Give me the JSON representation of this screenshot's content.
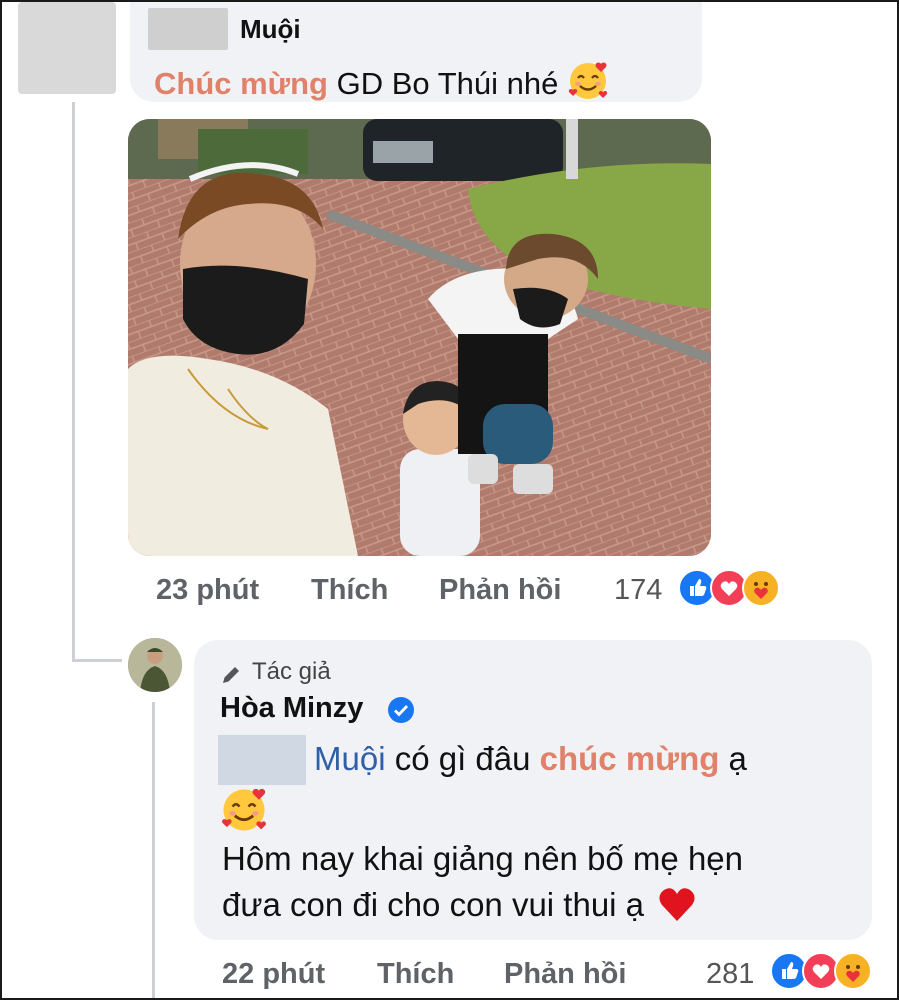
{
  "comment1": {
    "author": "Muội",
    "text_highlight": "Chúc mừng",
    "text_rest": " GD Bo Thúi nhé",
    "emoji": "smiling-face-with-hearts",
    "time": "23 phút",
    "like_label": "Thích",
    "reply_label": "Phản hồi",
    "reaction_count": "174",
    "reactions": [
      "like",
      "love",
      "care"
    ]
  },
  "reply": {
    "badge": "Tác giả",
    "author": "Hòa Minzy",
    "verified": true,
    "mention": "Muội",
    "text_mid": " có gì đâu ",
    "text_highlight": "chúc mừng",
    "text_end": " ạ",
    "line2": "Hôm nay khai giảng nên bố mẹ hẹn",
    "line3": "đưa con đi cho con vui thui ạ",
    "end_emoji": "red-heart",
    "time": "22 phút",
    "like_label": "Thích",
    "reply_label": "Phản hồi",
    "reaction_count": "281",
    "reactions": [
      "like",
      "love",
      "care"
    ]
  },
  "colors": {
    "highlight": "#e0826a",
    "mention": "#2f5fa8",
    "bubble": "#f0f2f5",
    "like": "#1877f2",
    "love": "#f33e58",
    "care": "#f7b125"
  }
}
